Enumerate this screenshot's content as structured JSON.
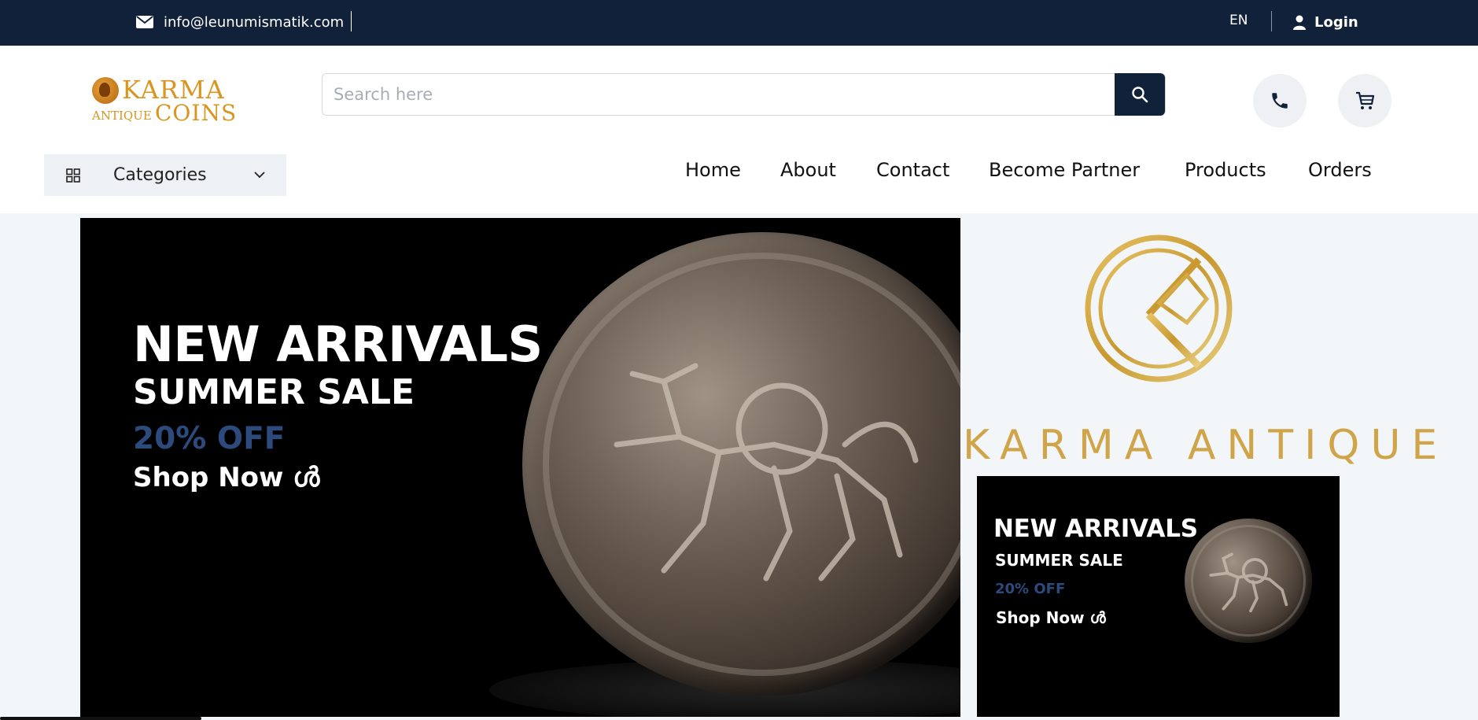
{
  "topbar": {
    "email": "info@leunumismatik.com",
    "email_icon": "envelope-icon",
    "language": "EN",
    "login_label": "Login",
    "login_icon": "user-icon"
  },
  "header": {
    "logo": {
      "word1": "KARMA",
      "word2": "ANTIQUE",
      "word3": "COINS"
    },
    "search": {
      "placeholder": "Search here",
      "value": "",
      "button_icon": "search-icon"
    },
    "phone_icon": "phone-icon",
    "cart_icon": "cart-icon"
  },
  "categories": {
    "label": "Categories",
    "icon": "grid-icon",
    "chevron": "chevron-down-icon"
  },
  "nav": {
    "items": [
      {
        "label": "Home"
      },
      {
        "label": "About"
      },
      {
        "label": "Contact"
      },
      {
        "label": "Become Partner"
      },
      {
        "label": "Products"
      },
      {
        "label": "Orders"
      }
    ]
  },
  "hero": {
    "line1": "NEW ARRIVALS",
    "line2": "SUMMER SALE",
    "line3": "20% OFF",
    "cta": "Shop Now ൾ"
  },
  "brand": {
    "name": "KARMA ANTIQUE",
    "color": "#d0a54a"
  },
  "promo": {
    "line1": "NEW ARRIVALS",
    "line2": "SUMMER SALE",
    "line3": "20% OFF",
    "cta": "Shop Now ൾ"
  },
  "colors": {
    "navy": "#12213a",
    "gold": "#d8951f",
    "accent_blue": "#2c4a7c"
  }
}
